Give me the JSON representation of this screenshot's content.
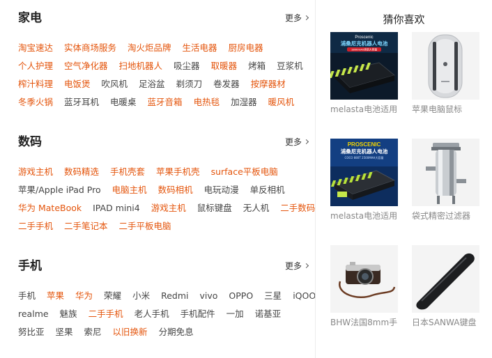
{
  "sections": [
    {
      "title": "家电",
      "more": "更多",
      "rows": [
        [
          {
            "t": "淘宝速达",
            "h": true
          },
          {
            "t": "实体商场服务",
            "h": true
          },
          {
            "t": "淘火炬品牌",
            "h": true
          },
          {
            "t": "生活电器",
            "h": true
          },
          {
            "t": "厨房电器",
            "h": true
          }
        ],
        [
          {
            "t": "个人护理",
            "h": true
          },
          {
            "t": "空气净化器",
            "h": true
          },
          {
            "t": "扫地机器人",
            "h": true
          },
          {
            "t": "吸尘器",
            "h": false
          },
          {
            "t": "取暖器",
            "h": true
          },
          {
            "t": "烤箱",
            "h": false
          },
          {
            "t": "豆浆机",
            "h": false
          }
        ],
        [
          {
            "t": "榨汁料理",
            "h": true
          },
          {
            "t": "电饭煲",
            "h": true
          },
          {
            "t": "吹风机",
            "h": false
          },
          {
            "t": "足浴盆",
            "h": false
          },
          {
            "t": "剃须刀",
            "h": false
          },
          {
            "t": "卷发器",
            "h": false
          },
          {
            "t": "按摩器材",
            "h": true
          }
        ],
        [
          {
            "t": "冬季火锅",
            "h": true
          },
          {
            "t": "蓝牙耳机",
            "h": false
          },
          {
            "t": "电暖桌",
            "h": false
          },
          {
            "t": "蓝牙音箱",
            "h": true
          },
          {
            "t": "电热毯",
            "h": true
          },
          {
            "t": "加湿器",
            "h": false
          },
          {
            "t": "暖风机",
            "h": true
          }
        ]
      ]
    },
    {
      "title": "数码",
      "more": "更多",
      "rows": [
        [
          {
            "t": "游戏主机",
            "h": true
          },
          {
            "t": "数码精选",
            "h": true
          },
          {
            "t": "手机壳套",
            "h": true
          },
          {
            "t": "苹果手机壳",
            "h": true
          },
          {
            "t": "surface平板电脑",
            "h": true
          }
        ],
        [
          {
            "t": "苹果/Apple iPad Pro",
            "h": false
          },
          {
            "t": "电脑主机",
            "h": true
          },
          {
            "t": "数码相机",
            "h": true
          },
          {
            "t": "电玩动漫",
            "h": false
          },
          {
            "t": "单反相机",
            "h": false
          }
        ],
        [
          {
            "t": "华为 MateBook",
            "h": true
          },
          {
            "t": "IPAD mini4",
            "h": false
          },
          {
            "t": "游戏主机",
            "h": true
          },
          {
            "t": "鼠标键盘",
            "h": false
          },
          {
            "t": "无人机",
            "h": false
          },
          {
            "t": "二手数码",
            "h": true
          }
        ],
        [
          {
            "t": "二手手机",
            "h": true
          },
          {
            "t": "二手笔记本",
            "h": true
          },
          {
            "t": "二手平板电脑",
            "h": true
          }
        ]
      ]
    },
    {
      "title": "手机",
      "more": "更多",
      "rows": [
        [
          {
            "t": "手机",
            "h": false
          },
          {
            "t": "苹果",
            "h": true
          },
          {
            "t": "华为",
            "h": true
          },
          {
            "t": "荣耀",
            "h": false
          },
          {
            "t": "小米",
            "h": false
          },
          {
            "t": "Redmi",
            "h": false
          },
          {
            "t": "vivo",
            "h": false
          },
          {
            "t": "OPPO",
            "h": false
          },
          {
            "t": "三星",
            "h": false
          },
          {
            "t": "iQOO",
            "h": false
          }
        ],
        [
          {
            "t": "realme",
            "h": false
          },
          {
            "t": "魅族",
            "h": false
          },
          {
            "t": "二手手机",
            "h": true
          },
          {
            "t": "老人手机",
            "h": false
          },
          {
            "t": "手机配件",
            "h": false
          },
          {
            "t": "一加",
            "h": false
          },
          {
            "t": "诺基亚",
            "h": false
          }
        ],
        [
          {
            "t": "努比亚",
            "h": false
          },
          {
            "t": "坚果",
            "h": false
          },
          {
            "t": "索尼",
            "h": false
          },
          {
            "t": "以旧换新",
            "h": true
          },
          {
            "t": "分期免息",
            "h": false
          }
        ]
      ]
    }
  ],
  "guess": {
    "title": "猜你喜欢",
    "products": [
      {
        "name": "melasta电池适用",
        "icon": "battery-charger-product-image",
        "banner": "Proscenic",
        "sub": "浦桑尼克机器人电池",
        "tag": "1800mAh续航大容量"
      },
      {
        "name": "苹果电脑鼠标",
        "icon": "magic-mouse-product-image"
      },
      {
        "name": "melasta电池适用",
        "icon": "battery-charger-product-image",
        "banner": "PROSCENIC",
        "sub": "浦桑尼克机器人电池",
        "tag": "COCO 880T    2500MAH大容量"
      },
      {
        "name": "袋式精密过滤器",
        "icon": "bag-filter-product-image"
      },
      {
        "name": "BHW法国8mm手",
        "icon": "camera-strap-product-image"
      },
      {
        "name": "日本SANWA键盘",
        "icon": "wrist-rest-product-image"
      }
    ]
  },
  "colors": {
    "accent": "#e4540b",
    "normal": "#444444",
    "muted": "#888888",
    "divider": "#ececec"
  }
}
